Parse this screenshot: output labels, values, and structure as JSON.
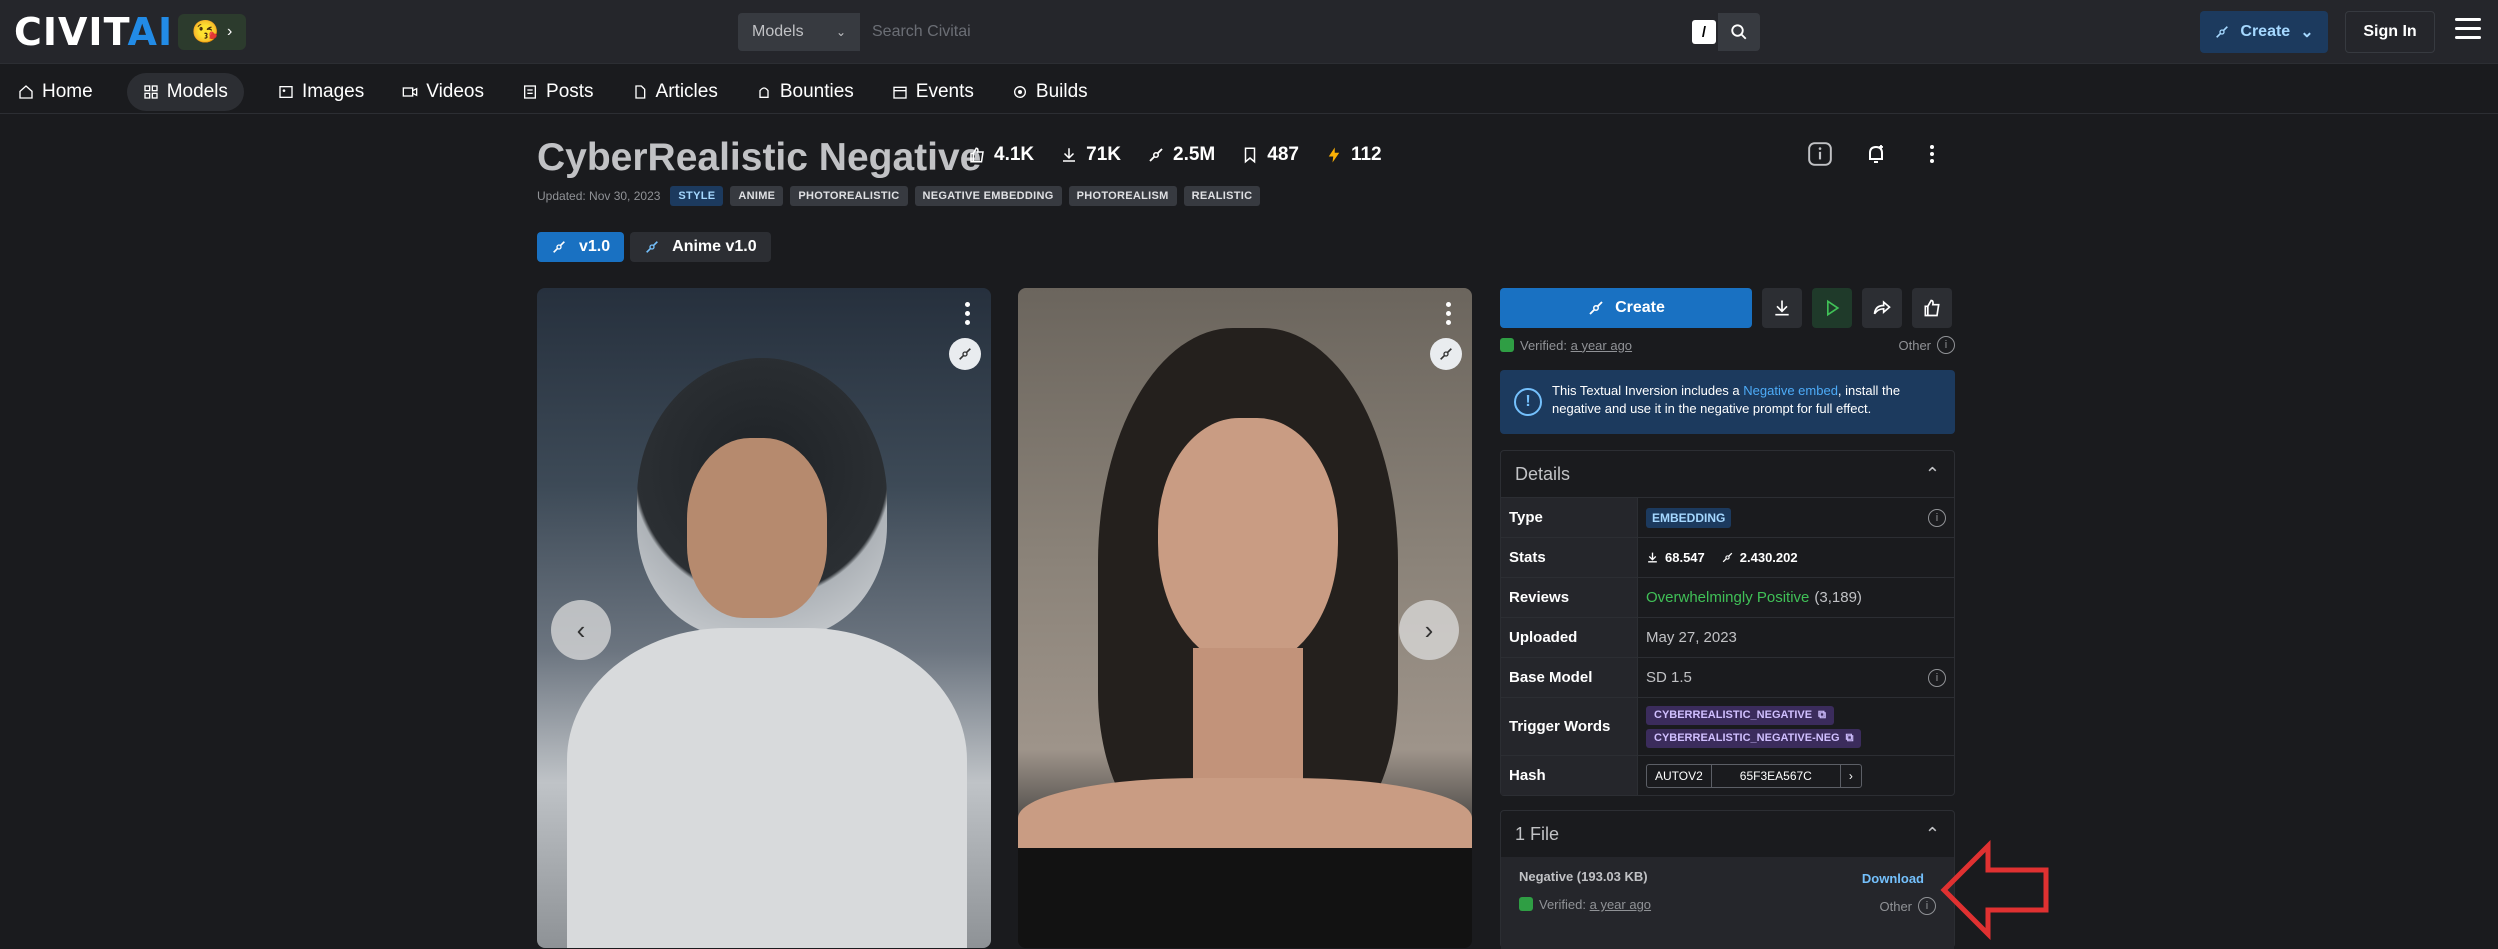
{
  "header": {
    "logo_main": "CIVIT",
    "logo_ai": "AI",
    "emoji": "😘",
    "search": {
      "category": "Models",
      "placeholder": "Search Civitai",
      "shortcut": "/"
    },
    "create_label": "Create",
    "signin_label": "Sign In"
  },
  "nav": {
    "items": [
      {
        "label": "Home",
        "icon": "home-icon"
      },
      {
        "label": "Models",
        "icon": "grid-icon"
      },
      {
        "label": "Images",
        "icon": "image-icon"
      },
      {
        "label": "Videos",
        "icon": "video-icon"
      },
      {
        "label": "Posts",
        "icon": "posts-icon"
      },
      {
        "label": "Articles",
        "icon": "article-icon"
      },
      {
        "label": "Bounties",
        "icon": "bounty-icon"
      },
      {
        "label": "Events",
        "icon": "calendar-icon"
      },
      {
        "label": "Builds",
        "icon": "builds-icon"
      }
    ]
  },
  "model": {
    "title": "CyberRealistic Negative",
    "stats": {
      "likes": "4.1K",
      "downloads": "71K",
      "generations": "2.5M",
      "bookmarks": "487",
      "buzz": "112"
    },
    "updated": "Updated: Nov 30, 2023",
    "tags": [
      "STYLE",
      "ANIME",
      "PHOTOREALISTIC",
      "NEGATIVE EMBEDDING",
      "PHOTOREALISM",
      "REALISTIC"
    ],
    "versions": [
      "v1.0",
      "Anime v1.0"
    ]
  },
  "sidebar": {
    "create_label": "Create",
    "verified_label": "Verified:",
    "verified_time": "a year ago",
    "other_label": "Other",
    "info_pre": "This Textual Inversion includes a ",
    "info_link": "Negative embed",
    "info_post": ", install the negative and use it in the negative prompt for full effect.",
    "details_title": "Details",
    "details": {
      "type_k": "Type",
      "type_v": "EMBEDDING",
      "stats_k": "Stats",
      "stats_downloads": "68.547",
      "stats_gens": "2.430.202",
      "reviews_k": "Reviews",
      "reviews_v": "Overwhelmingly Positive",
      "reviews_count": "(3,189)",
      "uploaded_k": "Uploaded",
      "uploaded_v": "May 27, 2023",
      "base_k": "Base Model",
      "base_v": "SD 1.5",
      "trigger_k": "Trigger Words",
      "trigger_1": "CYBERREALISTIC_NEGATIVE",
      "trigger_2": "CYBERREALISTIC_NEGATIVE-NEG",
      "hash_k": "Hash",
      "hash_type": "AUTOV2",
      "hash_v": "65F3EA567C"
    },
    "files_title": "1 File",
    "file": {
      "name": "Negative (193.03 KB)",
      "download": "Download",
      "verified_label": "Verified:",
      "verified_time": "a year ago",
      "other": "Other"
    }
  },
  "colors": {
    "accent": "#1971c2",
    "bg": "#1a1b1e",
    "green": "#40c057",
    "arrow": "#e03131"
  }
}
